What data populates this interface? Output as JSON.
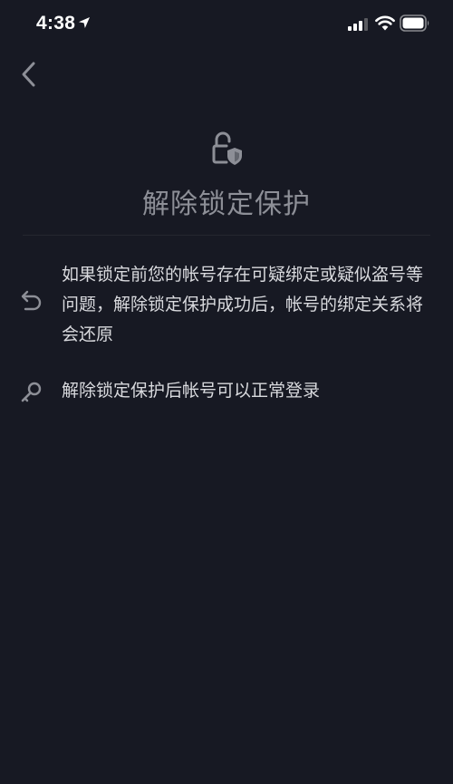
{
  "status_bar": {
    "time": "4:38",
    "icons": [
      "location-arrow-icon",
      "cellular-signal-icon",
      "wifi-icon",
      "battery-icon"
    ]
  },
  "nav": {
    "back_icon": "chevron-left-icon"
  },
  "header": {
    "icon": "unlock-shield-icon",
    "title": "解除锁定保护"
  },
  "info": [
    {
      "icon": "undo-arrow-icon",
      "text": "如果锁定前您的帐号存在可疑绑定或疑似盗号等问题，解除锁定保护成功后，帐号的绑定关系将会还原"
    },
    {
      "icon": "key-icon",
      "text": "解除锁定保护后帐号可以正常登录"
    }
  ],
  "colors": {
    "background": "#171923",
    "title": "#8d8f97",
    "text": "#d9dade",
    "icon": "#8d8f97"
  }
}
